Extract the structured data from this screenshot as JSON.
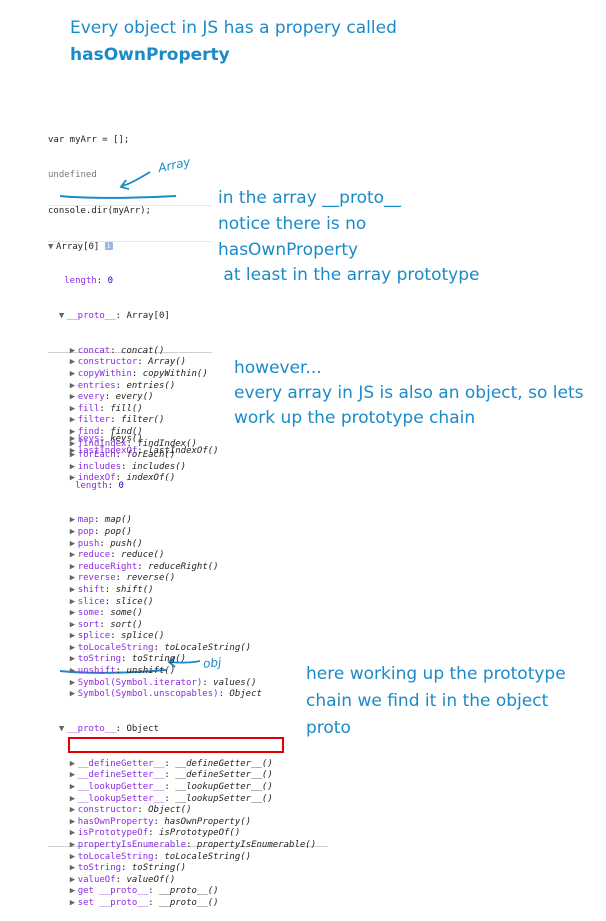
{
  "notes": {
    "intro_line1": "Every object in JS has a propery called",
    "intro_line2": "hasOwnProperty",
    "array_proto_1": "in the array __proto__",
    "array_proto_2": "notice there is no",
    "array_proto_3": "hasOwnProperty",
    "array_proto_4": " at least in the array prototype",
    "however_1": "however...",
    "however_2": "every array in JS is also an object, so lets",
    "however_3": "work up the prototype chain",
    "found_1": "here working up the prototype",
    "found_2": "chain we find it in the object",
    "found_3": "proto",
    "hand_array": "Array",
    "hand_obj": "obj"
  },
  "console1": {
    "input1": "var myArr = [];",
    "output1": "undefined",
    "input2": "console.dir(myArr);",
    "array_header": "Array[0]",
    "length_key": "length",
    "length_val": "0",
    "proto_key": "__proto__",
    "proto_val": "Array[0]",
    "methods": [
      {
        "key": "concat",
        "val": "concat()"
      },
      {
        "key": "constructor",
        "val": "Array()"
      },
      {
        "key": "copyWithin",
        "val": "copyWithin()"
      },
      {
        "key": "entries",
        "val": "entries()"
      },
      {
        "key": "every",
        "val": "every()"
      },
      {
        "key": "fill",
        "val": "fill()"
      },
      {
        "key": "filter",
        "val": "filter()"
      },
      {
        "key": "find",
        "val": "find()"
      },
      {
        "key": "findIndex",
        "val": "findIndex()"
      },
      {
        "key": "forEach",
        "val": "forEach()"
      },
      {
        "key": "includes",
        "val": "includes()"
      },
      {
        "key": "indexOf",
        "val": "indexOf()"
      }
    ]
  },
  "console2": {
    "methods_a": [
      {
        "key": "keys",
        "val": "keys()"
      },
      {
        "key": "lastIndexOf",
        "val": "lastIndexOf()"
      }
    ],
    "length_key": "length",
    "length_val": "0",
    "methods_b": [
      {
        "key": "map",
        "val": "map()"
      },
      {
        "key": "pop",
        "val": "pop()"
      },
      {
        "key": "push",
        "val": "push()"
      },
      {
        "key": "reduce",
        "val": "reduce()"
      },
      {
        "key": "reduceRight",
        "val": "reduceRight()"
      },
      {
        "key": "reverse",
        "val": "reverse()"
      },
      {
        "key": "shift",
        "val": "shift()"
      },
      {
        "key": "slice",
        "val": "slice()"
      },
      {
        "key": "some",
        "val": "some()"
      },
      {
        "key": "sort",
        "val": "sort()"
      },
      {
        "key": "splice",
        "val": "splice()"
      },
      {
        "key": "toLocaleString",
        "val": "toLocaleString()"
      },
      {
        "key": "toString",
        "val": "toString()"
      },
      {
        "key": "unshift",
        "val": "unshift()"
      },
      {
        "key": "Symbol(Symbol.iterator)",
        "val": "values()"
      },
      {
        "key": "Symbol(Symbol.unscopables)",
        "val": "Object"
      }
    ],
    "proto_key": "__proto__",
    "proto_val": "Object",
    "object_methods": [
      {
        "key": "__defineGetter__",
        "val": "__defineGetter__()"
      },
      {
        "key": "__defineSetter__",
        "val": "__defineSetter__()"
      },
      {
        "key": "__lookupGetter__",
        "val": "__lookupGetter__()"
      },
      {
        "key": "__lookupSetter__",
        "val": "__lookupSetter__()"
      },
      {
        "key": "constructor",
        "val": "Object()"
      },
      {
        "key": "hasOwnProperty",
        "val": "hasOwnProperty()"
      },
      {
        "key": "isPrototypeOf",
        "val": "isPrototypeOf()"
      },
      {
        "key": "propertyIsEnumerable",
        "val": "propertyIsEnumerable()"
      },
      {
        "key": "toLocaleString",
        "val": "toLocaleString()"
      },
      {
        "key": "toString",
        "val": "toString()"
      },
      {
        "key": "valueOf",
        "val": "valueOf()"
      },
      {
        "key": "get __proto__",
        "val": "__proto__()"
      },
      {
        "key": "set __proto__",
        "val": "__proto__()"
      }
    ]
  },
  "colors": {
    "note_blue": "#1a8ac9",
    "highlight_red": "#e00000"
  }
}
